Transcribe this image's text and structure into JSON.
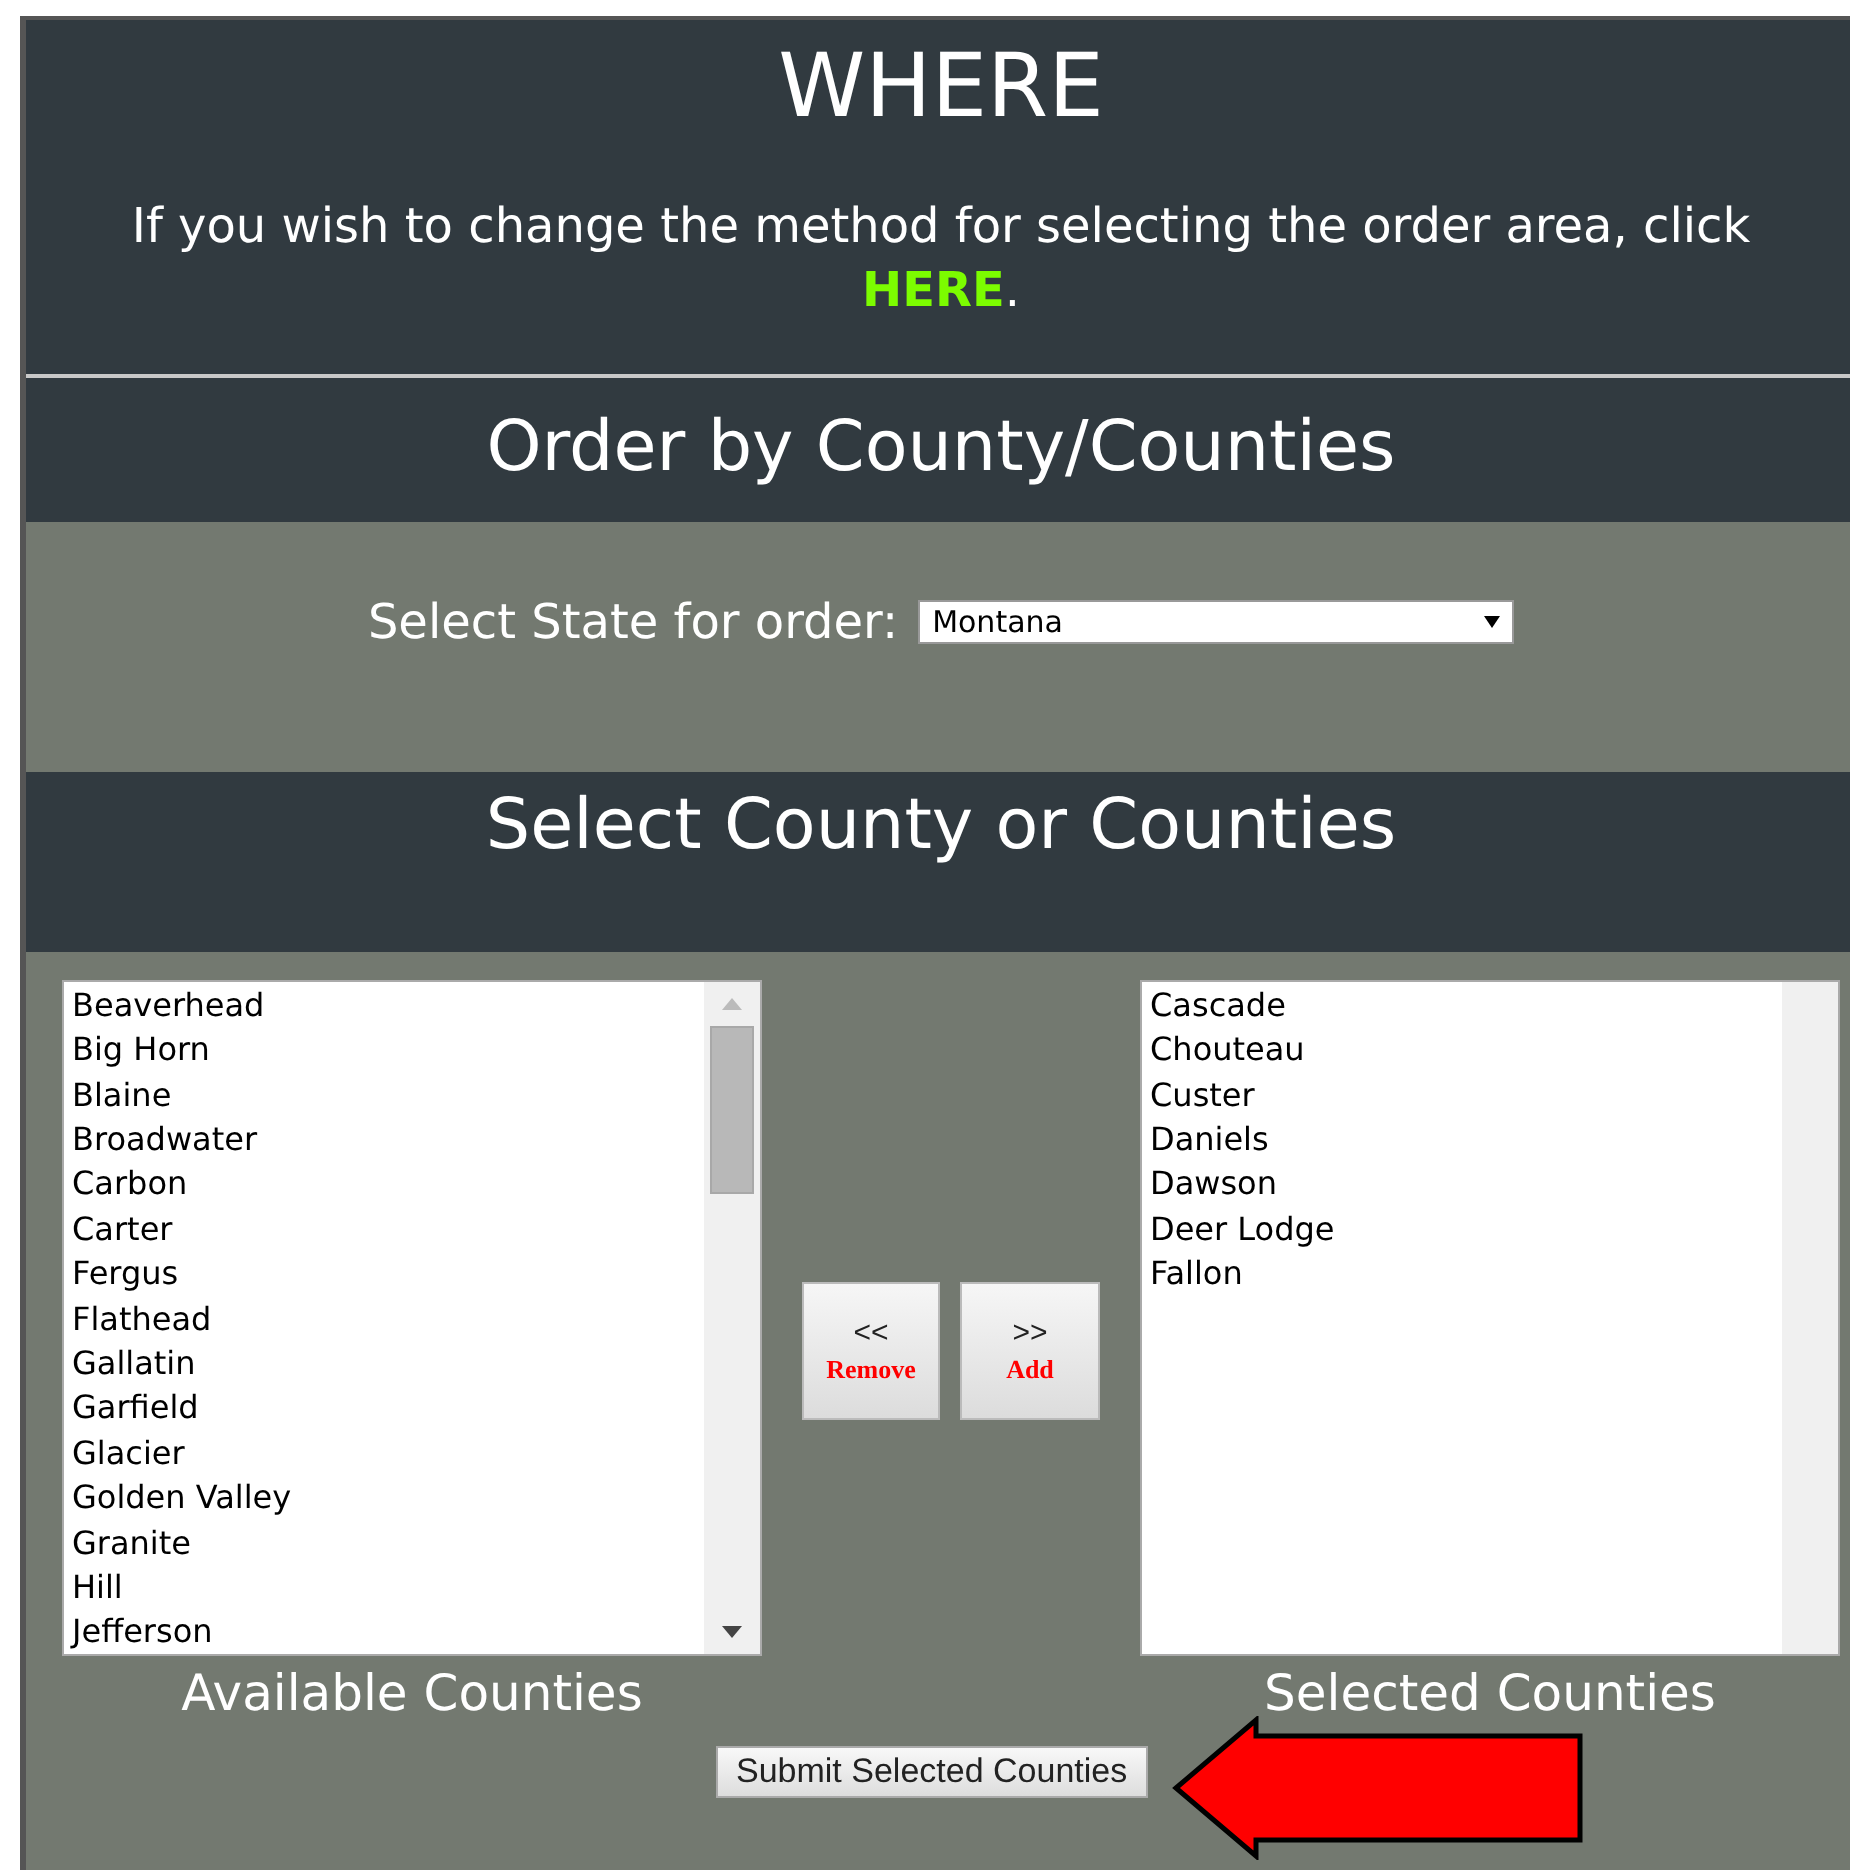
{
  "header": {
    "title": "WHERE",
    "message": "If you wish to change the method for selecting the order area, click",
    "link": "HERE",
    "link_suffix": "."
  },
  "county_section": {
    "title": "Order by County/Counties",
    "state_label": "Select State for order:",
    "state_value": "Montana"
  },
  "select_section": {
    "title": "Select County or Counties"
  },
  "available": {
    "label": "Available Counties",
    "items": [
      "Beaverhead",
      "Big Horn",
      "Blaine",
      "Broadwater",
      "Carbon",
      "Carter",
      "Fergus",
      "Flathead",
      "Gallatin",
      "Garfield",
      "Glacier",
      "Golden Valley",
      "Granite",
      "Hill",
      "Jefferson"
    ]
  },
  "selected": {
    "label": "Selected Counties",
    "items": [
      "Cascade",
      "Chouteau",
      "Custer",
      "Daniels",
      "Dawson",
      "Deer Lodge",
      "Fallon"
    ]
  },
  "buttons": [
    {
      "kind": "remove",
      "symbol": "<<",
      "label": "Remove"
    },
    {
      "kind": "add",
      "symbol": ">>",
      "label": "Add"
    }
  ],
  "submit": "Submit Selected Counties"
}
